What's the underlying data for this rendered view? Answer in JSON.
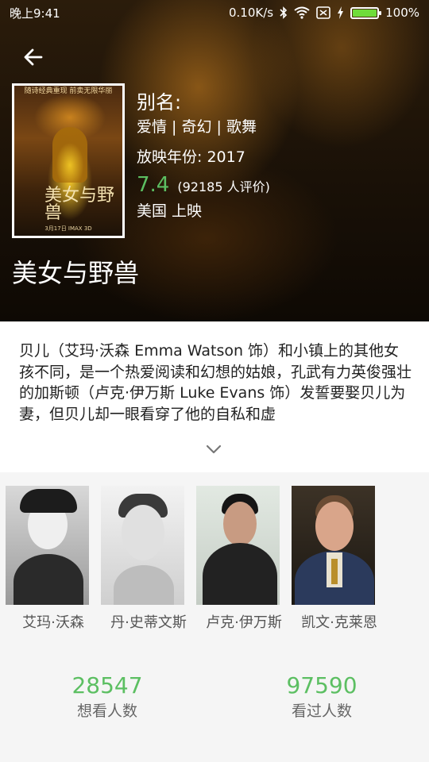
{
  "status_bar": {
    "time": "晚上9:41",
    "network_speed": "0.10K/s",
    "battery_percent": "100%",
    "battery_level": 1.0
  },
  "movie": {
    "poster": {
      "top_text": "随诗经典重现 前卖无限华丽",
      "title_text": "美女与野兽",
      "bottom_text": "3月17日 IMAX 3D"
    },
    "alias_label": "别名:",
    "genres": "爱情 | 奇幻 | 歌舞",
    "year_label": "放映年份: 2017",
    "rating": "7.4",
    "votes": "(92185 人评价)",
    "region": "美国 上映",
    "title": "美女与野兽"
  },
  "synopsis": {
    "text": "贝儿（艾玛·沃森 Emma Watson 饰）和小镇上的其他女孩不同，是一个热爱阅读和幻想的姑娘，孔武有力英俊强壮的加斯顿（卢克·伊万斯 Luke Evans 饰）发誓要娶贝儿为妻，但贝儿却一眼看穿了他的自私和虚"
  },
  "cast": [
    {
      "name": "艾玛·沃森"
    },
    {
      "name": "丹·史蒂文斯"
    },
    {
      "name": "卢克·伊万斯"
    },
    {
      "name": "凯文·克莱恩"
    }
  ],
  "stats": {
    "want_count": "28547",
    "want_label": "想看人数",
    "seen_count": "97590",
    "seen_label": "看过人数"
  },
  "colors": {
    "accent_green": "#5cbf62",
    "header_dark": "#1a1107"
  },
  "icons": [
    "back-arrow-icon",
    "bluetooth-icon",
    "wifi-icon",
    "sim-icon",
    "charging-icon",
    "battery-icon",
    "chevron-down-icon"
  ]
}
